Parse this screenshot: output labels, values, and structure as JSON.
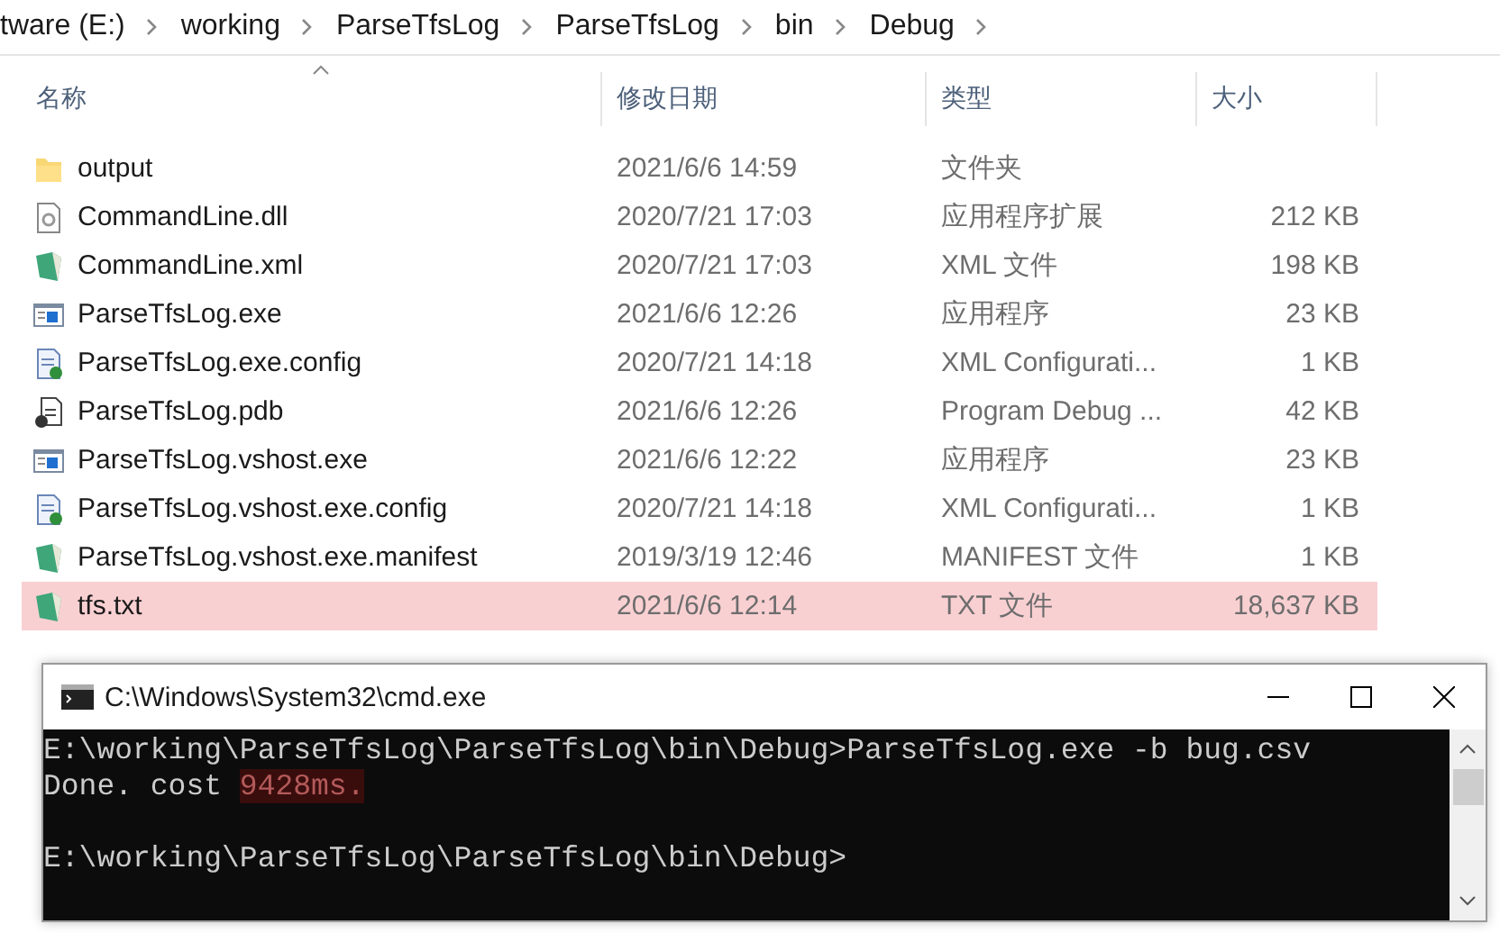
{
  "breadcrumb": [
    "tware (E:)",
    "working",
    "ParseTfsLog",
    "ParseTfsLog",
    "bin",
    "Debug"
  ],
  "columns": [
    {
      "label": "名称",
      "sorted": true
    },
    {
      "label": "修改日期",
      "sorted": false
    },
    {
      "label": "类型",
      "sorted": false
    },
    {
      "label": "大小",
      "sorted": false
    }
  ],
  "files": [
    {
      "name": "output",
      "modified": "2021/6/6 14:59",
      "type": "文件夹",
      "kind": "folder",
      "selected": false
    },
    {
      "name": "CommandLine.dll",
      "modified": "2020/7/21 17:03",
      "type": "应用程序扩展",
      "size": "212 KB",
      "kind": "dll",
      "selected": false
    },
    {
      "name": "CommandLine.xml",
      "modified": "2020/7/21 17:03",
      "type": "XML 文件",
      "size": "198 KB",
      "kind": "doc",
      "selected": false
    },
    {
      "name": "ParseTfsLog.exe",
      "modified": "2021/6/6 12:26",
      "type": "应用程序",
      "size": "23 KB",
      "kind": "exe",
      "selected": false
    },
    {
      "name": "ParseTfsLog.exe.config",
      "modified": "2020/7/21 14:18",
      "type": "XML Configurati...",
      "size": "1 KB",
      "kind": "config",
      "selected": false
    },
    {
      "name": "ParseTfsLog.pdb",
      "modified": "2021/6/6 12:26",
      "type": "Program Debug ...",
      "size": "42 KB",
      "kind": "pdb",
      "selected": false
    },
    {
      "name": "ParseTfsLog.vshost.exe",
      "modified": "2021/6/6 12:22",
      "type": "应用程序",
      "size": "23 KB",
      "kind": "exe",
      "selected": false
    },
    {
      "name": "ParseTfsLog.vshost.exe.config",
      "modified": "2020/7/21 14:18",
      "type": "XML Configurati...",
      "size": "1 KB",
      "kind": "config",
      "selected": false
    },
    {
      "name": "ParseTfsLog.vshost.exe.manifest",
      "modified": "2019/3/19 12:46",
      "type": "MANIFEST 文件",
      "size": "1 KB",
      "kind": "doc",
      "selected": false
    },
    {
      "name": "tfs.txt",
      "modified": "2021/6/6 12:14",
      "type": "TXT 文件",
      "size": "18,637 KB",
      "kind": "doc",
      "selected": true
    }
  ],
  "console": {
    "title": "C:\\Windows\\System32\\cmd.exe",
    "lines": [
      {
        "kind": "text",
        "segments": [
          {
            "text": "E:\\working\\ParseTfsLog\\ParseTfsLog\\bin\\Debug>ParseTfsLog.exe -b bug.csv",
            "highlighted": false
          }
        ]
      },
      {
        "kind": "text",
        "segments": [
          {
            "text": "Done. cost ",
            "highlighted": false
          },
          {
            "text": "9428ms.",
            "highlighted": true
          }
        ]
      },
      {
        "kind": "blank"
      },
      {
        "kind": "text",
        "segments": [
          {
            "text": "E:\\working\\ParseTfsLog\\ParseTfsLog\\bin\\Debug>",
            "highlighted": false
          }
        ]
      }
    ]
  }
}
